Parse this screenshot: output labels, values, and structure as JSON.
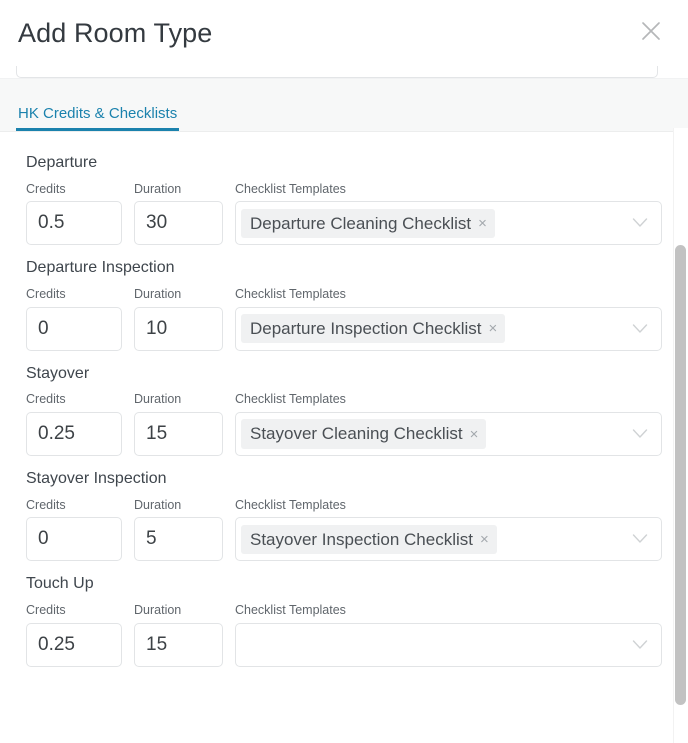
{
  "modal": {
    "title": "Add Room Type",
    "close_icon": "close-icon"
  },
  "tabs": [
    {
      "label": "HK Credits & Checklists",
      "active": true
    }
  ],
  "labels": {
    "credits": "Credits",
    "duration": "Duration",
    "templates": "Checklist Templates"
  },
  "icons": {
    "chevron_down": "chevron-down-icon",
    "chip_remove": "×"
  },
  "colors": {
    "accent": "#1b82ad",
    "tab_bar_bg": "#f7f8f8",
    "chip_bg": "#f0f1f2",
    "border": "#e2e4e6",
    "text": "#3f464d",
    "muted": "#60666c",
    "scrollbar_thumb": "#c2c2c2"
  },
  "sections": [
    {
      "title": "Departure",
      "credits": "0.5",
      "duration": "30",
      "templates": [
        "Departure Cleaning Checklist"
      ]
    },
    {
      "title": "Departure Inspection",
      "credits": "0",
      "duration": "10",
      "templates": [
        "Departure Inspection Checklist"
      ]
    },
    {
      "title": "Stayover",
      "credits": "0.25",
      "duration": "15",
      "templates": [
        "Stayover Cleaning Checklist"
      ]
    },
    {
      "title": "Stayover Inspection",
      "credits": "0",
      "duration": "5",
      "templates": [
        "Stayover Inspection Checklist"
      ]
    },
    {
      "title": "Touch Up",
      "credits": "0.25",
      "duration": "15",
      "templates": []
    }
  ]
}
